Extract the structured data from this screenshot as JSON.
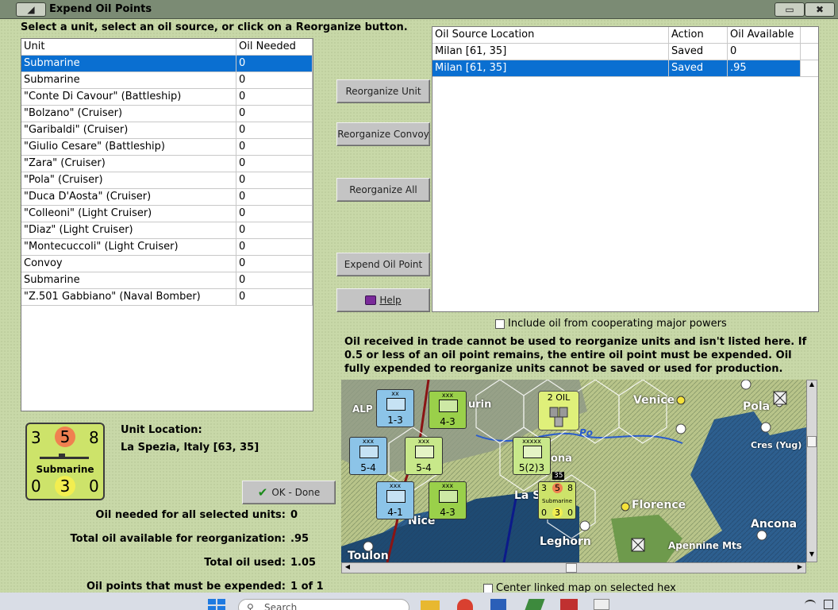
{
  "window": {
    "title": "Expend Oil Points"
  },
  "instruction": "Select a unit, select an oil source, or click on a Reorganize button.",
  "units_table": {
    "headers": [
      "Unit",
      "Oil Needed"
    ],
    "rows": [
      [
        "Submarine",
        "0"
      ],
      [
        "Submarine",
        "0"
      ],
      [
        "\"Conte Di Cavour\" (Battleship)",
        "0"
      ],
      [
        "\"Bolzano\" (Cruiser)",
        "0"
      ],
      [
        "\"Garibaldi\" (Cruiser)",
        "0"
      ],
      [
        "\"Giulio Cesare\" (Battleship)",
        "0"
      ],
      [
        "\"Zara\" (Cruiser)",
        "0"
      ],
      [
        "\"Pola\" (Cruiser)",
        "0"
      ],
      [
        "\"Duca D'Aosta\" (Cruiser)",
        "0"
      ],
      [
        "\"Colleoni\" (Light Cruiser)",
        "0"
      ],
      [
        "\"Diaz\" (Light Cruiser)",
        "0"
      ],
      [
        "\"Montecuccoli\" (Light Cruiser)",
        "0"
      ],
      [
        "Convoy",
        "0"
      ],
      [
        "Submarine",
        "0"
      ],
      [
        "\"Z.501 Gabbiano\" (Naval Bomber)",
        "0"
      ]
    ]
  },
  "source_table": {
    "headers": [
      "Oil Source Location",
      "Action",
      "Oil Available"
    ],
    "rows": [
      [
        "Milan [61, 35]",
        "Saved",
        "0"
      ],
      [
        "Milan [61, 35]",
        "Saved",
        ".95"
      ]
    ]
  },
  "buttons": {
    "reorganize_unit": "Reorganize Unit",
    "reorganize_convoy": "Reorganize Convoy",
    "reorganize_all": "Reorganize All",
    "expend_oil_point": "Expend Oil Point",
    "help": "Help",
    "ok_done": "OK - Done"
  },
  "include_oil_label": "Include oil from cooperating major powers",
  "notice": "Oil received in trade cannot be used to reorganize units and isn't listed here.  If 0.5 or less of an oil point remains, the entire oil point must be expended.   Oil fully expended to reorganize units cannot be saved or used for production.",
  "counter": {
    "top_left": "3",
    "top_mid": "5",
    "top_right": "8",
    "name": "Submarine",
    "bot_left": "0",
    "bot_mid": "3",
    "bot_right": "0"
  },
  "unit_location": {
    "label": "Unit Location:",
    "value": "La Spezia, Italy [63, 35]"
  },
  "summary": {
    "oil_needed_label": "Oil needed for all selected units:",
    "oil_needed": "0",
    "total_available_label": "Total oil available for reorganization:",
    "total_available": ".95",
    "total_used_label": "Total oil used:",
    "total_used": "1.05",
    "must_expend_label": "Oil points that must be expended:",
    "must_expend": "1 of 1"
  },
  "center_map_label": "Center linked map on selected hex",
  "map_labels": {
    "alp": "ALP",
    "urin": "urin",
    "venice": "Venice",
    "pola": "Pola",
    "po": "Po",
    "cres": "Cres (Yug)",
    "ona": "ona",
    "las": "La S",
    "florence": "Florence",
    "nice": "Nice",
    "ancona": "Ancona",
    "leghorn": "Leghorn",
    "apennine": "Apennine Mts",
    "toulon": "Toulon",
    "oil": "2 OIL",
    "hex_35": "35"
  },
  "map_units": [
    {
      "type": "xx",
      "value": "1-3",
      "color": "#8cc4e8"
    },
    {
      "type": "xxx",
      "value": "4-3",
      "color": "#9ad04a"
    },
    {
      "type": "xxx",
      "value": "5-4",
      "color": "#8cc4e8"
    },
    {
      "type": "xxx",
      "value": "5-4",
      "color": "#c8e88a"
    },
    {
      "type": "xxxxx",
      "value": "5(2)3",
      "color": "#c8e88a"
    },
    {
      "type": "xxx",
      "value": "4-1",
      "color": "#8cc4e8"
    },
    {
      "type": "xxx",
      "value": "4-3",
      "color": "#9ad04a"
    }
  ],
  "map_counter": {
    "tl": "3",
    "tm": "5",
    "tr": "8",
    "name": "Submarine",
    "bl": "0",
    "bm": "3",
    "br": "0"
  },
  "taskbar": {
    "search_placeholder": "Search"
  }
}
